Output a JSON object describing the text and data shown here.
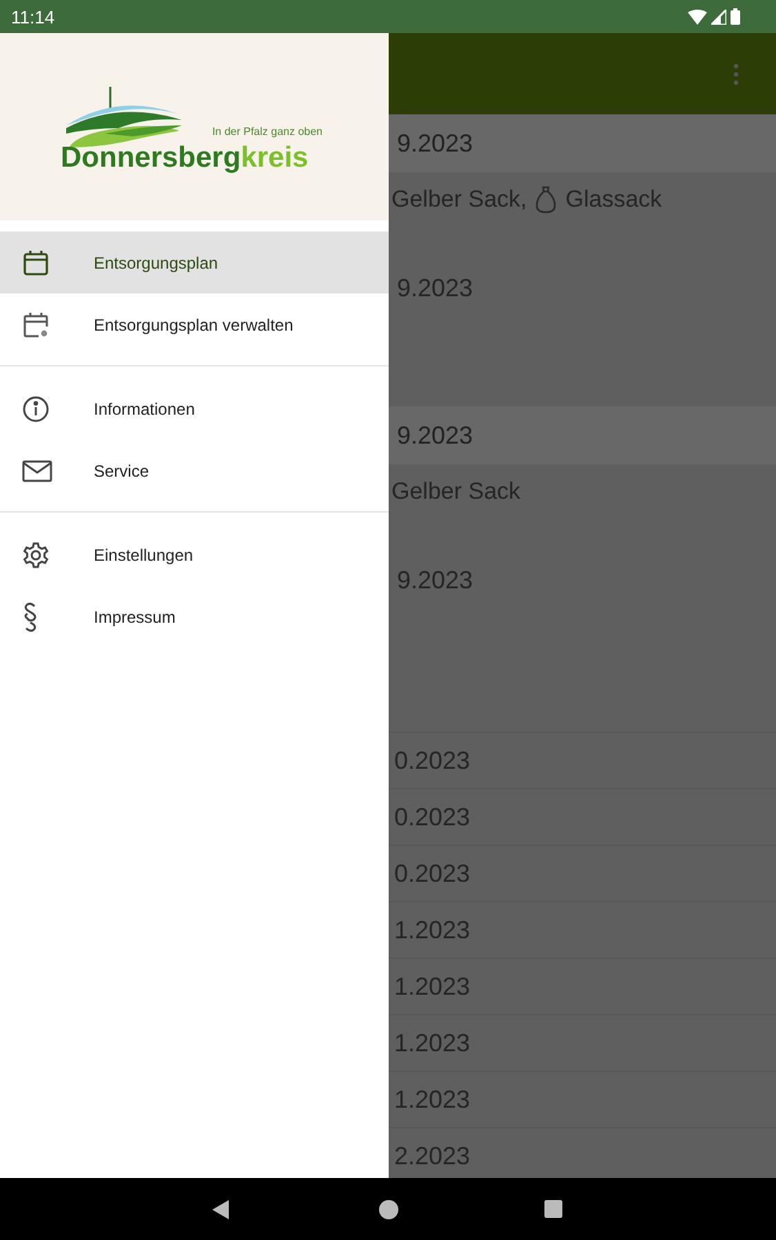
{
  "status_bar": {
    "time": "11:14"
  },
  "drawer": {
    "logo": {
      "tagline": "In der Pfalz ganz oben",
      "name_main": "Donnersberg",
      "name_accent": "kreis"
    },
    "sections": [
      {
        "items": [
          {
            "label": "Entsorgungsplan",
            "selected": true
          },
          {
            "label": "Entsorgungsplan verwalten",
            "selected": false
          }
        ]
      },
      {
        "items": [
          {
            "label": "Informationen",
            "selected": false
          },
          {
            "label": "Service",
            "selected": false
          }
        ]
      },
      {
        "items": [
          {
            "label": "Einstellungen",
            "selected": false
          },
          {
            "label": "Impressum",
            "selected": false
          }
        ]
      }
    ]
  },
  "background_list": {
    "groups": [
      {
        "header": "9.2023",
        "lines": [
          {
            "kind": "waste",
            "text": "Gelber Sack,",
            "extra": "Glassack"
          },
          {
            "kind": "date",
            "text": "9.2023"
          }
        ]
      },
      {
        "header": "9.2023",
        "lines": [
          {
            "kind": "waste",
            "text": "Gelber Sack"
          },
          {
            "kind": "date",
            "text": "9.2023"
          }
        ]
      }
    ],
    "rows": [
      "0.2023",
      "0.2023",
      "0.2023",
      "1.2023",
      "1.2023",
      "1.2023",
      "1.2023",
      "2.2023"
    ]
  }
}
